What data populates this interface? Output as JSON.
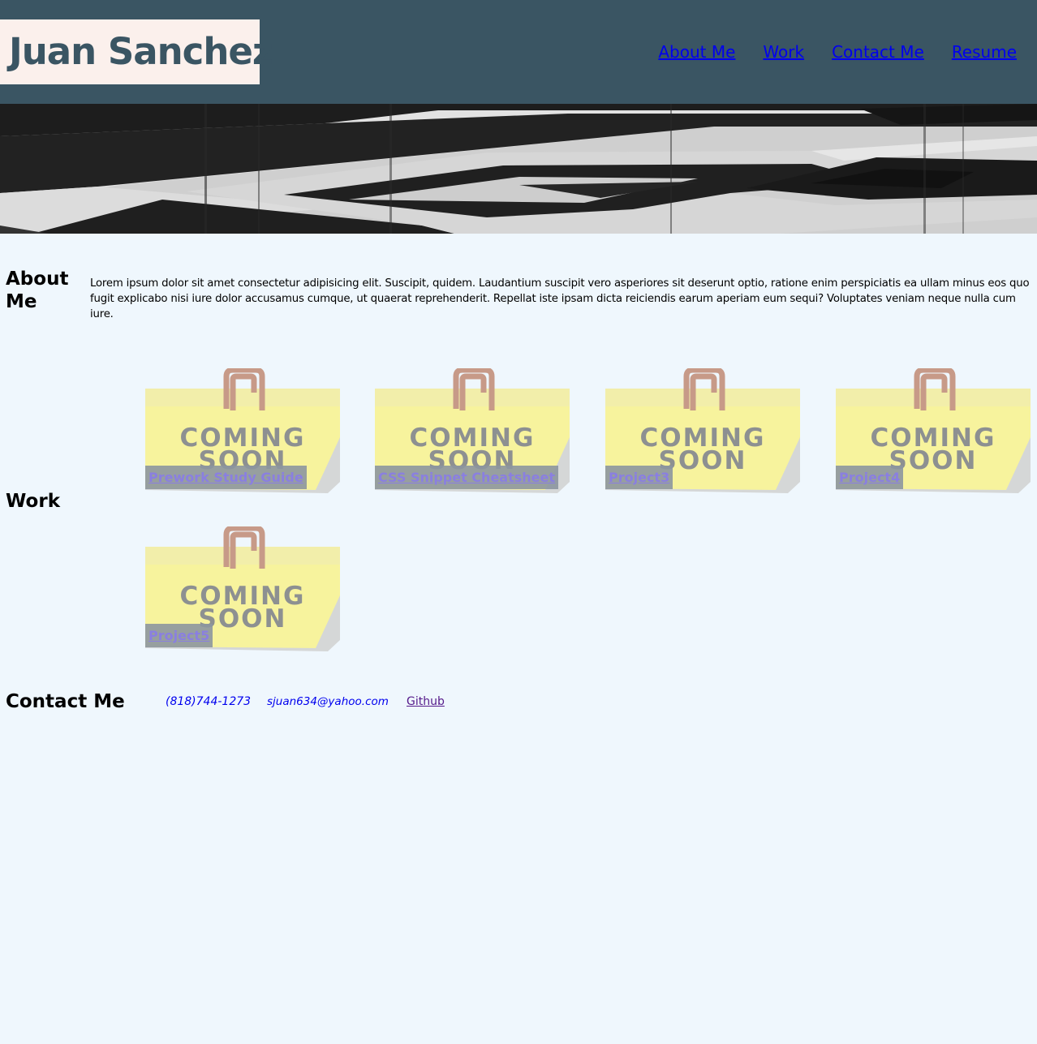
{
  "header": {
    "name": "Juan Sanchez",
    "nav": [
      {
        "label": "About Me"
      },
      {
        "label": "Work"
      },
      {
        "label": "Contact Me"
      },
      {
        "label": "Resume"
      }
    ]
  },
  "about": {
    "title": "About Me",
    "text": "Lorem ipsum dolor sit amet consectetur adipisicing elit. Suscipit, quidem. Laudantium suscipit vero asperiores sit deserunt optio, ratione enim perspiciatis ea ullam minus eos quo fugit explicabo nisi iure dolor accusamus cumque, ut quaerat reprehenderit. Repellat iste ipsam dicta reiciendis earum aperiam eum sequi? Voluptates veniam neque nulla cum iure."
  },
  "work": {
    "title": "Work",
    "placeholder_line1": "COMING",
    "placeholder_line2": "SOON",
    "projects": [
      {
        "label": "Prework Study Guide"
      },
      {
        "label": "CSS Snippet Cheatsheet"
      },
      {
        "label": "Project3"
      },
      {
        "label": "Project4"
      },
      {
        "label": "Project5"
      }
    ]
  },
  "contact": {
    "title": "Contact Me",
    "phone": "(818)744-1273",
    "email": "sjuan634@yahoo.com",
    "github": "Github"
  },
  "colors": {
    "header_bg": "#3a5563",
    "logo_bg": "#fbf0ec",
    "page_bg": "#eff7fd",
    "link": "#0000ee",
    "visited_link": "#551a8b"
  }
}
